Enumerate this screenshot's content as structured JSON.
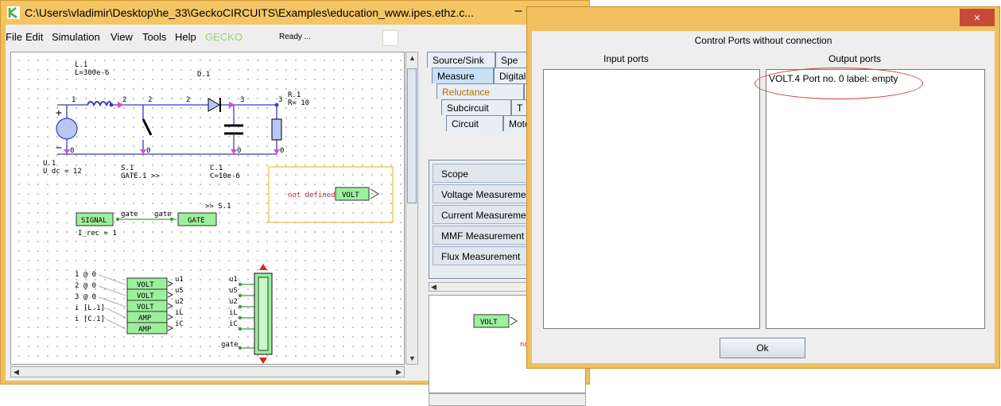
{
  "main_window": {
    "title": "C:\\Users\\vladimir\\Desktop\\he_33\\GeckoCIRCUITS\\Examples\\education_www.ipes.ethz.c...",
    "minimize_label": "–"
  },
  "menu": {
    "items": [
      "File",
      "Edit",
      "Simulation",
      "View",
      "Tools",
      "Help",
      "GECKO"
    ],
    "status": "Ready ..."
  },
  "schematic": {
    "labels": {
      "l1": "L.1",
      "l1_value": "L=300e-6",
      "d1": "D.1",
      "r1": "R.1",
      "r1_value": "R= 10",
      "u1": "U.1",
      "u1_value": "U dc = 12",
      "s1": "S.1",
      "s1_gate": "GATE.1 >>",
      "c1": "C.1",
      "c1_value": "C=10e-6",
      "node_1": "1",
      "node_2a": "2",
      "node_2b": "2",
      "node_2c": "2",
      "node_3a": "3",
      "node_3b": "3",
      "node_0a": "0",
      "node_0b": "0",
      "node_0c": "0",
      "node_0d": "0",
      "node_0e": "0",
      "plus": "+",
      "minus": "−",
      "not_defined": "not defined",
      "volt_block": "VOLT",
      "signal": "SIGNAL",
      "gate_out": "gate",
      "gate_in": "gate",
      "gate_block": "GATE",
      "gate_target": ">> S.1",
      "i_rec": "I_rec = 1",
      "m1": "1 @ 0",
      "m2": "2 @ 0",
      "m3": "3 @ 0",
      "m4": "i [L.1]",
      "m5": "i [C.1]",
      "b1": "VOLT",
      "b2": "VOLT",
      "b3": "VOLT",
      "b4": "AMP",
      "b5": "AMP",
      "o1": "u1",
      "o2": "uS",
      "o3": "u2",
      "o4": "iL",
      "o5": "iC",
      "s_in1": "u1",
      "s_in2": "uS",
      "s_in3": "u2",
      "s_in4": "iL",
      "s_in5": "iC",
      "s_in6": "gate"
    }
  },
  "library": {
    "tabs": [
      "Source/Sink",
      "Spe",
      "Measure",
      "Digital",
      "Reluctance",
      "",
      "Subcircuit",
      "T",
      "Circuit",
      "Moto"
    ],
    "components": [
      "Scope",
      "Voltage Measurement",
      "Current Measurement",
      "MMF Measurement",
      "Flux Measurement"
    ],
    "preview_volt": "VOLT",
    "preview_partial": "not"
  },
  "dialog": {
    "close_label": "×",
    "title": "Control Ports without connection",
    "input_header": "Input ports",
    "output_header": "Output ports",
    "input_ports": [],
    "output_ports": [
      "VOLT.4 Port no. 0 label: empty"
    ],
    "ok_label": "Ok"
  },
  "colors": {
    "window_frame": "#f0c060",
    "block_fill": "#9cf09c",
    "annotation": "#d33a3a",
    "accent": "#3b3bc8"
  }
}
